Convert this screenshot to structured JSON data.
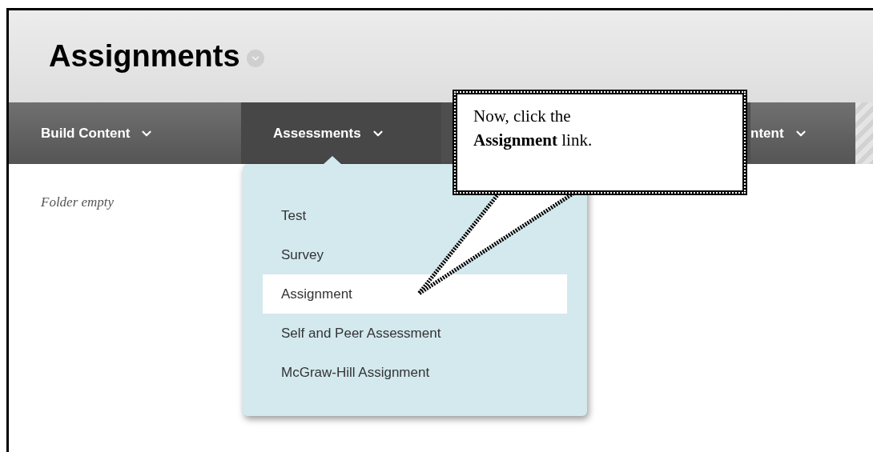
{
  "page_title": "Assignments",
  "nav_tabs": [
    {
      "label": "Build Content",
      "selected": false
    },
    {
      "label": "Assessments",
      "selected": true
    },
    {
      "label": "ntent",
      "selected": false
    }
  ],
  "dropdown_items": [
    {
      "label": "Test",
      "selected": false
    },
    {
      "label": "Survey",
      "selected": false
    },
    {
      "label": "Assignment",
      "selected": true
    },
    {
      "label": "Self and Peer Assessment",
      "selected": false
    },
    {
      "label": "McGraw-Hill Assignment",
      "selected": false
    }
  ],
  "empty_message": "Folder empty",
  "callout": {
    "text": "Now, click the **Assignment** link."
  }
}
